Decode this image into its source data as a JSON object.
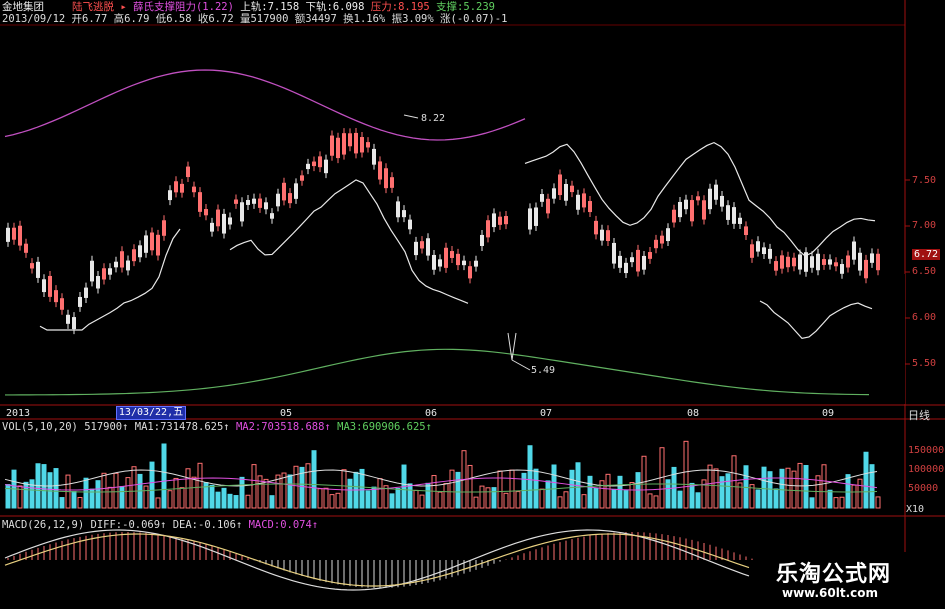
{
  "header": {
    "stock_name": "金地集团",
    "indicator_name": "陆飞逃脱",
    "sub_indicator": "薛氏支撑阻力(1.22)",
    "upper_label": "上轨:",
    "upper_value": "7.158",
    "lower_label": "下轨:",
    "lower_value": "6.098",
    "pressure_label": "压力:",
    "pressure_value": "8.195",
    "support_label": "支撑:",
    "support_value": "5.239",
    "ticker_row": "2013/09/12 开6.77 高6.79 低6.58 收6.72 量517900 额34497 换1.16% 振3.09% 涨(-0.07)-1"
  },
  "price_axis": [
    "7.50",
    "7.00",
    "6.50",
    "6.00",
    "5.50"
  ],
  "current_price": "6.72",
  "annotations": {
    "high": "8.22",
    "low": "5.49"
  },
  "x_axis": {
    "year": "2013",
    "cursor_date": "13/03/22,五",
    "months": [
      "05",
      "06",
      "07",
      "08",
      "09"
    ],
    "period": "日线"
  },
  "volume_panel": {
    "title": "VOL(5,10,20)",
    "vol": "517900",
    "ma1": "MA1:731478.625",
    "ma2": "MA2:703518.688",
    "ma3": "MA3:690906.625",
    "axis": [
      "150000",
      "100000",
      "50000"
    ],
    "unit": "X10"
  },
  "macd_panel": {
    "title": "MACD(26,12,9)",
    "diff": "DIFF:-0.069",
    "dea": "DEA:-0.106",
    "macd": "MACD:0.074"
  },
  "watermark": {
    "name": "乐淘公式网",
    "url": "www.60lt.com"
  },
  "colors": {
    "up": "#ff7070",
    "down": "#e8e8e8",
    "vol_down": "#50d8e8",
    "ma_long": "#c050c0",
    "ma_low": "#60b060",
    "band": "#e8e8e8",
    "fast": "#3030d0",
    "axis": "#a01010"
  }
}
